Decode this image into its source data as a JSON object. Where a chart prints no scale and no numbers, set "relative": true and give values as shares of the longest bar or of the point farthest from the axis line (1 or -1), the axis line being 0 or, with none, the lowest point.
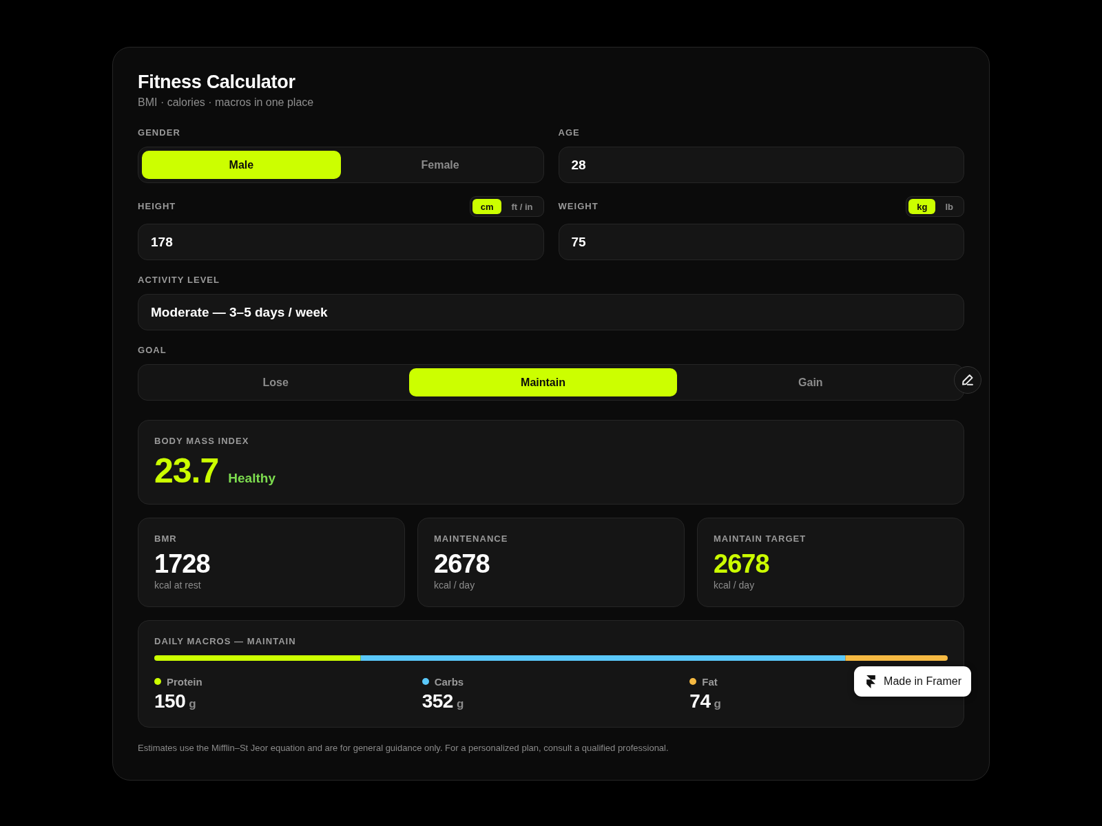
{
  "header": {
    "title": "Fitness Calculator",
    "subtitle": "BMI · calories · macros in one place"
  },
  "gender": {
    "label": "GENDER",
    "options": [
      {
        "label": "Male",
        "selected": true
      },
      {
        "label": "Female",
        "selected": false
      }
    ]
  },
  "age": {
    "label": "AGE",
    "value": "28"
  },
  "height": {
    "label": "HEIGHT",
    "units": [
      {
        "label": "cm",
        "selected": true
      },
      {
        "label": "ft / in",
        "selected": false
      }
    ],
    "value": "178"
  },
  "weight": {
    "label": "WEIGHT",
    "units": [
      {
        "label": "kg",
        "selected": true
      },
      {
        "label": "lb",
        "selected": false
      }
    ],
    "value": "75"
  },
  "activity": {
    "label": "ACTIVITY LEVEL",
    "value": "Moderate — 3–5 days / week"
  },
  "goal": {
    "label": "GOAL",
    "options": [
      {
        "label": "Lose",
        "selected": false
      },
      {
        "label": "Maintain",
        "selected": true
      },
      {
        "label": "Gain",
        "selected": false
      }
    ]
  },
  "bmi": {
    "label": "BODY MASS INDEX",
    "value": "23.7",
    "category": "Healthy"
  },
  "stats": [
    {
      "label": "BMR",
      "value": "1728",
      "unit": "kcal at rest",
      "highlight": false
    },
    {
      "label": "MAINTENANCE",
      "value": "2678",
      "unit": "kcal / day",
      "highlight": false
    },
    {
      "label": "MAINTAIN TARGET",
      "value": "2678",
      "unit": "kcal / day",
      "highlight": true
    }
  ],
  "macros": {
    "title": "DAILY MACROS — MAINTAIN",
    "chart_data": {
      "type": "bar",
      "orientation": "horizontal",
      "stacked": true,
      "relative": true,
      "legend": "bottom",
      "series": [
        {
          "name": "Protein",
          "color": "#ccff00",
          "values": [
            0.26
          ]
        },
        {
          "name": "Carbs",
          "color": "#5ac8fa",
          "values": [
            0.611
          ]
        },
        {
          "name": "Fat",
          "color": "#f5b942",
          "values": [
            0.129
          ]
        }
      ]
    },
    "amounts": [
      {
        "value": "150",
        "unit": "g"
      },
      {
        "value": "352",
        "unit": "g"
      },
      {
        "value": "74",
        "unit": "g"
      }
    ]
  },
  "footnote": "Estimates use the Mifflin–St Jeor equation and are for general guidance only. For a personalized plan, consult a qualified professional.",
  "badge": {
    "label": "Made in Framer"
  }
}
